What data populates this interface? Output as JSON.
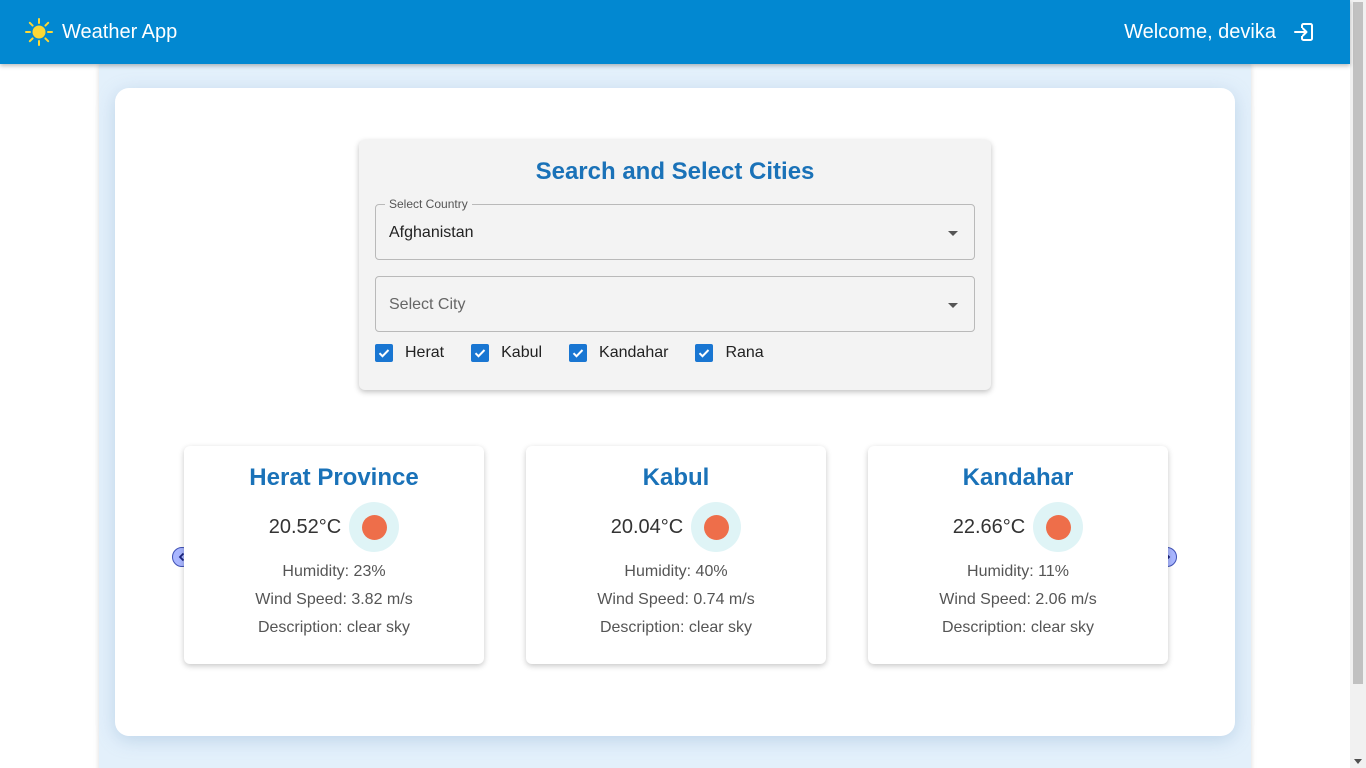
{
  "header": {
    "title": "Weather App",
    "welcome": "Welcome, devika",
    "brand_icon": "sun-icon",
    "logout_icon": "logout-icon",
    "bar_color": "#0288d1"
  },
  "search": {
    "title": "Search and Select Cities",
    "country_label": "Select Country",
    "country_value": "Afghanistan",
    "city_placeholder": "Select City",
    "cities": [
      {
        "label": "Herat",
        "checked": true
      },
      {
        "label": "Kabul",
        "checked": true
      },
      {
        "label": "Kandahar",
        "checked": true
      },
      {
        "label": "Rana",
        "checked": true
      }
    ]
  },
  "cards": [
    {
      "title": "Herat Province",
      "temp": "20.52°C",
      "humidity": "Humidity: 23%",
      "wind": "Wind Speed: 3.82 m/s",
      "description": "Description: clear sky"
    },
    {
      "title": "Kabul",
      "temp": "20.04°C",
      "humidity": "Humidity: 40%",
      "wind": "Wind Speed: 0.74 m/s",
      "description": "Description: clear sky"
    },
    {
      "title": "Kandahar",
      "temp": "22.66°C",
      "humidity": "Humidity: 11%",
      "wind": "Wind Speed: 2.06 m/s",
      "description": "Description: clear sky"
    }
  ],
  "carousel": {
    "prev_icon": "chevron-left-icon",
    "next_icon": "chevron-right-icon"
  }
}
